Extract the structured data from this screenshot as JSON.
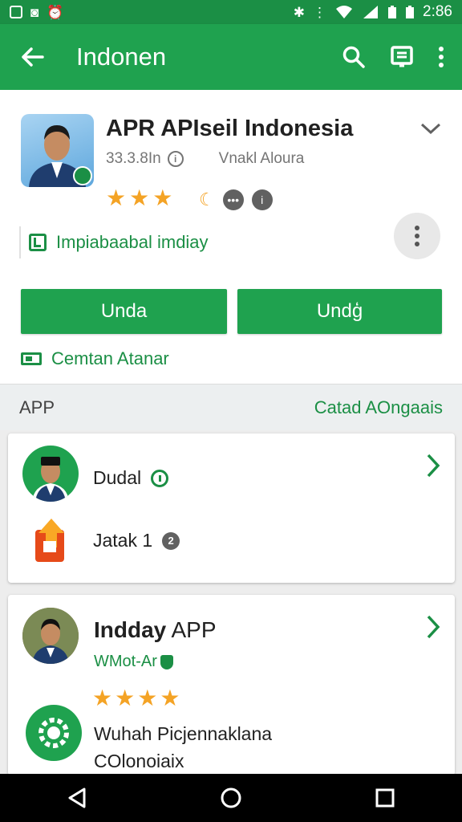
{
  "status_bar": {
    "time": "2:86"
  },
  "app_bar": {
    "title": "Indonen"
  },
  "app_header": {
    "title": "APR APIseil Indonesia",
    "size": "33.3.8In",
    "developer": "Vnakl Aloura",
    "rating_stars": 3,
    "feature_text": "Impiabaabal imdiay",
    "primary_button": "Unda",
    "secondary_button": "Undģ",
    "link_text": "Cemtan Atanar"
  },
  "section": {
    "label": "APP",
    "action": "Catad AOngaais"
  },
  "card1": {
    "rows": [
      {
        "label": "Dudal"
      },
      {
        "label": "Jatak 1"
      }
    ]
  },
  "card2": {
    "app_name_bold": "Indday",
    "app_name_rest": " APP",
    "developer": "WMot-Ar",
    "rating_stars": 4,
    "line1": "Wuhah Picjennaklana",
    "line2": "COlonoiaix"
  },
  "colors": {
    "primary_green": "#1fa24f",
    "dark_green": "#1b8f45",
    "star": "#f4a325"
  }
}
